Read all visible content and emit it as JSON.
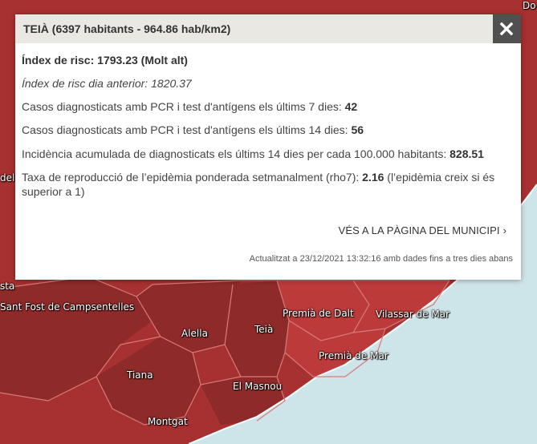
{
  "map": {
    "colors": {
      "land_dark": "#8e2a2a",
      "land_mid": "#a73030",
      "land_light": "#bd3a3a",
      "boundary": "#d77a7a",
      "sea": "#cde4e8",
      "coast": "#ffffff"
    },
    "labels": [
      {
        "id": "teia",
        "text": "Teià"
      },
      {
        "id": "premia-de-dalt",
        "text": "Premià de Dalt"
      },
      {
        "id": "vilassar-de-mar",
        "text": "Vilassar de Mar"
      },
      {
        "id": "premia-de-mar",
        "text": "Premià de Mar"
      },
      {
        "id": "sant-fost",
        "text": "Sant Fost de Campsentelles"
      },
      {
        "id": "alella",
        "text": "Alella"
      },
      {
        "id": "tiana",
        "text": "Tiana"
      },
      {
        "id": "el-masnou",
        "text": "El Masnou"
      },
      {
        "id": "montgat",
        "text": "Montgat"
      },
      {
        "id": "sta",
        "text": "sta"
      },
      {
        "id": "del-v",
        "text": "del V"
      },
      {
        "id": "do",
        "text": "Do"
      }
    ]
  },
  "popup": {
    "title": "TEIÀ (6397 habitants - 964.86 hab/km2)",
    "close_icon": "close-x-icon",
    "risk": {
      "label": "Índex de risc:",
      "value": "1793.23",
      "category": "(Molt alt)"
    },
    "risk_previous": {
      "label": "Índex de risc dia anterior:",
      "value": "1820.37"
    },
    "cases_7": {
      "label": "Casos diagnosticats amb PCR i test d'antígens els últims 7 dies:",
      "value": "42"
    },
    "cases_14": {
      "label": "Casos diagnosticats amb PCR i test d'antígens els últims 14 dies:",
      "value": "56"
    },
    "incidence": {
      "label": "Incidència acumulada de diagnosticats els últims 14 dies per cada 100.000 habitants:",
      "value": "828.51"
    },
    "rho7": {
      "label": "Taxa de reproducció de l’epidèmia ponderada setmanalment (rho7):",
      "value": "2.16",
      "note": "(l’epidèmia creix si és superior a 1)"
    },
    "municipality_link": "VÉS A LA PÀGINA DEL MUNICIPI",
    "updated": "Actualitzat a 23/12/2021 13:32:16 amb dades fins a tres dies abans"
  }
}
